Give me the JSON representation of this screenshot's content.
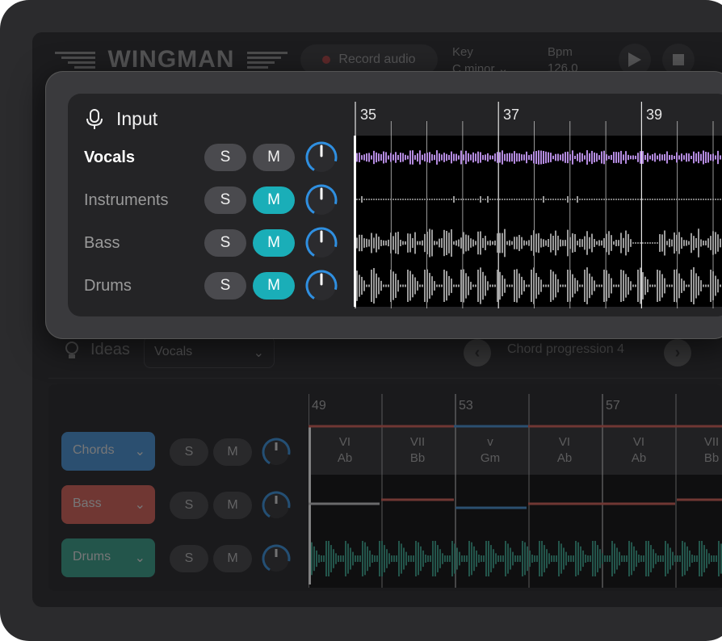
{
  "background_app": {
    "logo_text": "WINGMAN",
    "record_button": "Record audio",
    "key": {
      "label": "Key",
      "value": "C minor"
    },
    "bpm": {
      "label": "Bpm",
      "value": "126.0"
    },
    "ideas": {
      "label": "Ideas",
      "select_value": "Vocals",
      "chord_progression_label": "Chord progression 4"
    },
    "lower_bar_numbers": [
      "49",
      "53",
      "57"
    ],
    "chords": [
      {
        "degree": "VI",
        "name": "Ab"
      },
      {
        "degree": "VII",
        "name": "Bb"
      },
      {
        "degree": "v",
        "name": "Gm"
      },
      {
        "degree": "VI",
        "name": "Ab"
      },
      {
        "degree": "VI",
        "name": "Ab"
      },
      {
        "degree": "VII",
        "name": "Bb"
      }
    ],
    "tracks": [
      {
        "label": "Chords",
        "color": "#3f8fd6"
      },
      {
        "label": "Bass",
        "color": "#d85a4f"
      },
      {
        "label": "Drums",
        "color": "#2d9c84"
      }
    ],
    "solo_label": "S",
    "mute_label": "M"
  },
  "input_panel": {
    "title": "Input",
    "bar_numbers": [
      "35",
      "37",
      "39"
    ],
    "tracks": [
      {
        "name": "Vocals",
        "solo": "S",
        "mute": "M",
        "mute_on": false,
        "active": true,
        "wave_color": "#b48be0"
      },
      {
        "name": "Instruments",
        "solo": "S",
        "mute": "M",
        "mute_on": true,
        "active": false,
        "wave_color": "#9a9a9a"
      },
      {
        "name": "Bass",
        "solo": "S",
        "mute": "M",
        "mute_on": true,
        "active": false,
        "wave_color": "#9a9a9a"
      },
      {
        "name": "Drums",
        "solo": "S",
        "mute": "M",
        "mute_on": true,
        "active": false,
        "wave_color": "#9a9a9a"
      }
    ],
    "accent_color": "#1aaeb8",
    "knob_color": "#2f8fe0"
  }
}
